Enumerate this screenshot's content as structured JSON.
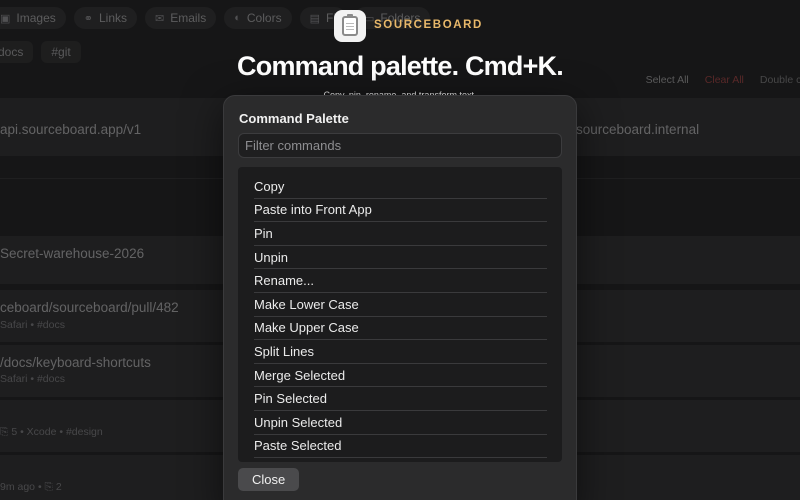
{
  "background": {
    "filters": [
      {
        "icon": "image-icon",
        "glyph": "▣",
        "label": "Images"
      },
      {
        "icon": "link-icon",
        "glyph": "⚭",
        "label": "Links"
      },
      {
        "icon": "email-icon",
        "glyph": "✉",
        "label": "Emails"
      },
      {
        "icon": "palette-icon",
        "glyph": "◐",
        "label": "Colors"
      },
      {
        "icon": "file-icon",
        "glyph": "▤",
        "label": "Fi"
      },
      {
        "icon": "folder-icon",
        "glyph": "▭",
        "label": "Folders"
      }
    ],
    "tags": [
      "docs",
      "#git"
    ],
    "selection": {
      "select_all": "Select All",
      "clear_all": "Clear All",
      "double_click": "Double cli"
    },
    "rows": [
      {
        "title": "api.sourceboard.app/v1",
        "right": "sourceboard.internal",
        "meta": ""
      },
      {
        "title": "",
        "right": "",
        "meta": ""
      },
      {
        "title": "Secret-warehouse-2026",
        "right": "",
        "meta": ""
      },
      {
        "title": "ceboard/sourceboard/pull/482",
        "right": "",
        "meta": "Safari   •   #docs"
      },
      {
        "title": "/docs/keyboard-shortcuts",
        "right": "",
        "meta": "Safari   •   #docs"
      },
      {
        "title": "",
        "right": "",
        "meta": "⎘ 5   •   Xcode   •   #design"
      },
      {
        "title": "",
        "right": "",
        "meta": "9m ago   •   ⎘ 2"
      }
    ]
  },
  "hero": {
    "brand": "SOURCEBOARD",
    "headline": "Command palette. Cmd+K.",
    "subhead": "Copy, pin, rename, and transform text."
  },
  "palette": {
    "title": "Command Palette",
    "filter_placeholder": "Filter commands",
    "filter_value": "",
    "commands": [
      "Copy",
      "Paste into Front App",
      "Pin",
      "Unpin",
      "Rename...",
      "Make Lower Case",
      "Make Upper Case",
      "Split Lines",
      "Merge Selected",
      "Pin Selected",
      "Unpin Selected",
      "Paste Selected"
    ],
    "close_label": "Close"
  },
  "colors": {
    "background": "#1e1e1f",
    "brand": "#e8b86a",
    "clear_all": "#8a3b3b",
    "palette_bg": "#2b2b2c"
  }
}
